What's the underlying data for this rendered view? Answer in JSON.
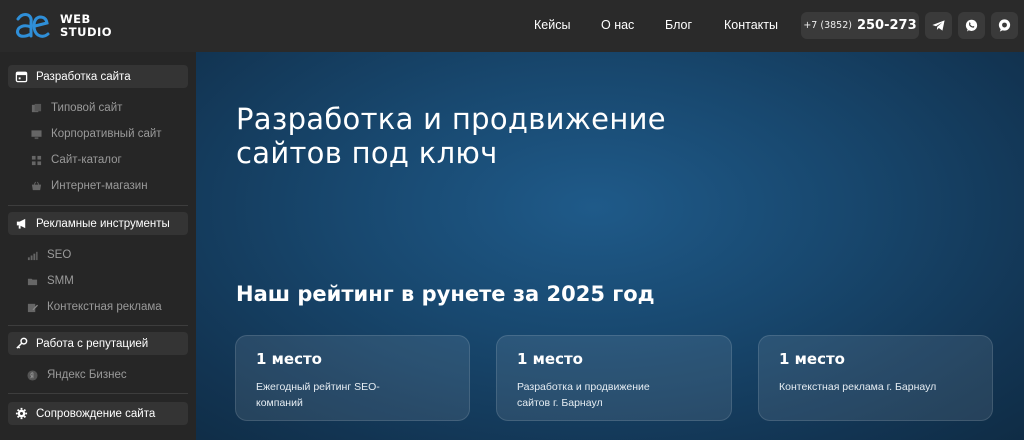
{
  "header": {
    "logo_line1": "WEB",
    "logo_line2": "STUDIO",
    "nav": [
      "Кейсы",
      "О нас",
      "Блог",
      "Контакты"
    ],
    "phone_code": "+7 (3852)",
    "phone_number": "250-273",
    "social_icons": [
      "telegram-icon",
      "whatsapp-icon",
      "chat-icon"
    ]
  },
  "sidebar": {
    "sections": [
      {
        "label": "Разработка сайта",
        "icon": "calendar-icon",
        "items": [
          {
            "label": "Типовой сайт",
            "icon": "pages-icon"
          },
          {
            "label": "Корпоративный сайт",
            "icon": "monitor-icon"
          },
          {
            "label": "Сайт-каталог",
            "icon": "catalog-icon"
          },
          {
            "label": "Интернет-магазин",
            "icon": "basket-icon"
          }
        ]
      },
      {
        "label": "Рекламные инструменты",
        "icon": "megaphone-icon",
        "items": [
          {
            "label": "SEO",
            "icon": "bars-icon"
          },
          {
            "label": "SMM",
            "icon": "folder-icon"
          },
          {
            "label": "Контекстная реклама",
            "icon": "edit-icon"
          }
        ]
      },
      {
        "label": "Работа с репутацией",
        "icon": "key-icon",
        "items": [
          {
            "label": "Яндекс Бизнес",
            "icon": "yandex-icon"
          }
        ]
      },
      {
        "label": "Сопровождение сайта",
        "icon": "gear-icon",
        "items": []
      }
    ]
  },
  "hero": {
    "title_line1": "Разработка и продвижение",
    "title_line2": "сайтов под ключ",
    "rating_title": "Наш рейтинг в рунете за 2025 год",
    "cards": [
      {
        "place": "1 место",
        "desc_line1": "Ежегодный рейтинг SEO-",
        "desc_line2": "компаний"
      },
      {
        "place": "1 место",
        "desc_line1": "Разработка и продвижение",
        "desc_line2": "сайтов г. Барнаул"
      },
      {
        "place": "1 место",
        "desc_line1": "Контекстная реклама г. Барнаул",
        "desc_line2": ""
      }
    ]
  },
  "colors": {
    "header_bg": "#2a2a2a",
    "sidebar_bg": "#262626",
    "hero_bg": "#1a4c75",
    "logo_accent": "#2f8fd8"
  }
}
